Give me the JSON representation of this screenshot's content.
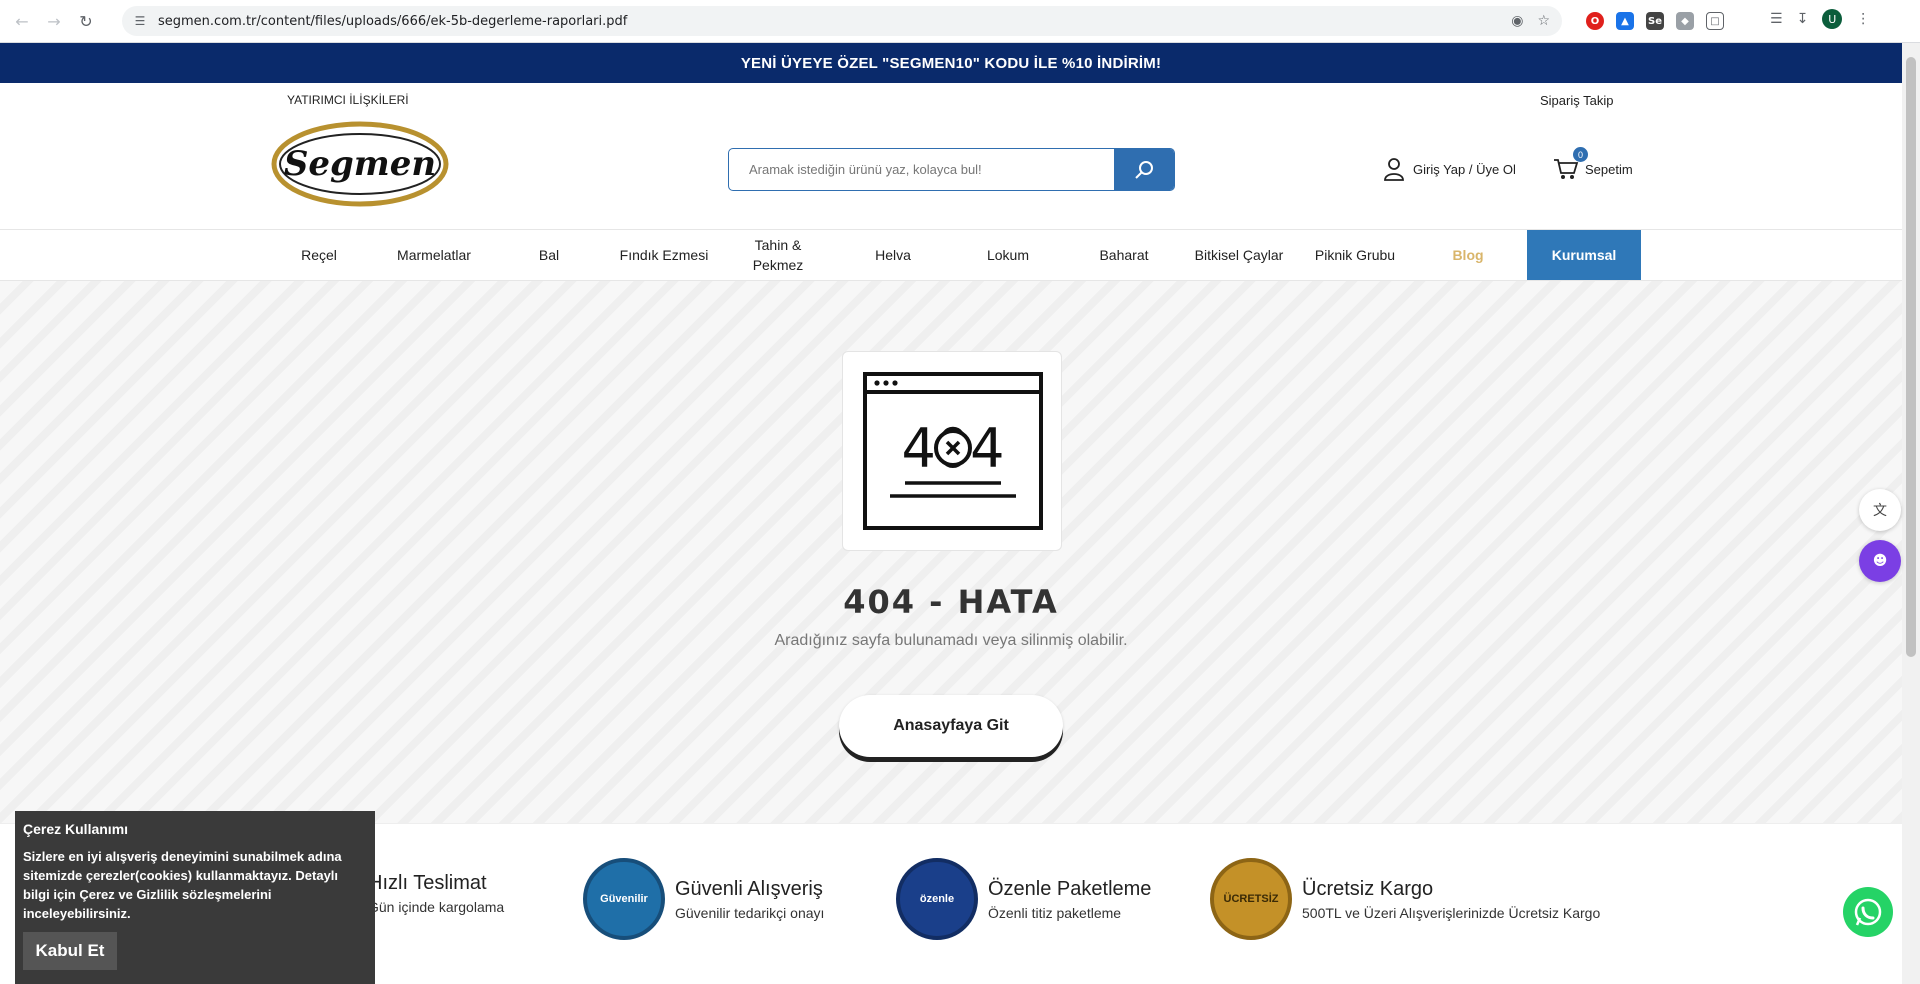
{
  "browser": {
    "url": "segmen.com.tr/content/files/uploads/666/ek-5b-degerleme-raporlari.pdf",
    "profile_initial": "U"
  },
  "promo": {
    "text": "YENİ ÜYEYE ÖZEL \"SEGMEN10\" KODU İLE %10 İNDİRİM!"
  },
  "topline": {
    "investor": "YATIRIMCI İLİŞKİLERİ",
    "order_tracking": "Sipariş Takip"
  },
  "header": {
    "logo_text": "Segmen",
    "search_placeholder": "Aramak istediğin ürünü yaz, kolayca bul!",
    "login": "Giriş Yap / Üye Ol",
    "cart_count": "0",
    "cart_label": "Sepetim"
  },
  "menu": {
    "items": [
      "Reçel",
      "Marmelatlar",
      "Bal",
      "Fındık Ezmesi",
      "Tahin & Pekmez",
      "Helva",
      "Lokum",
      "Baharat",
      "Bitkisel Çaylar",
      "Piknik Grubu",
      "Blog",
      "Kurumsal"
    ]
  },
  "error": {
    "title": "404 - HATA",
    "subtitle": "Aradığınız sayfa bulunamadı veya silinmiş olabilir.",
    "home_button": "Anasayfaya Git",
    "icon_text": "404"
  },
  "features": [
    {
      "title": "Hızlı Teslimat",
      "desc": "Gün içinde kargolama",
      "seal": ""
    },
    {
      "title": "Güvenli Alışveriş",
      "desc": "Güvenilir tedarikçi onayı",
      "seal": "Güvenilir"
    },
    {
      "title": "Özenle Paketleme",
      "desc": "Özenli titiz paketleme",
      "seal": "özenle"
    },
    {
      "title": "Ücretsiz Kargo",
      "desc": "500TL ve Üzeri Alışverişlerinizde Ücretsiz Kargo",
      "seal": "ÜCRETSİZ"
    }
  ],
  "cookie": {
    "title": "Çerez Kullanımı",
    "body": "Sizlere en iyi alışveriş deneyimini sunabilmek adına sitemizde çerezler(cookies) kullanmaktayız. Detaylı bilgi için Çerez ve Gizlilik sözleşmelerini inceleyebilirsiniz.",
    "accept": "Kabul Et"
  },
  "colors": {
    "promo_bg": "#0a2a6b",
    "brand_blue": "#2f78b8",
    "blog_gold": "#d9b56a"
  }
}
